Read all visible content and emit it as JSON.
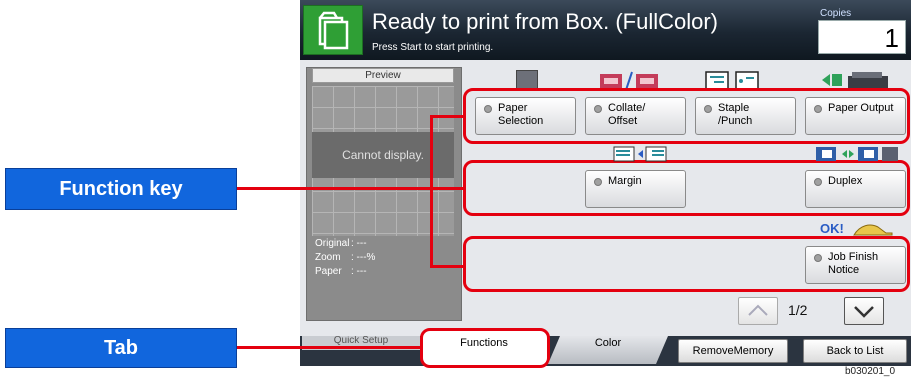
{
  "header": {
    "title": "Ready to print from Box. (FullColor)",
    "subtitle": "Press Start to start printing.",
    "copies_label": "Copies",
    "copies_value": "1"
  },
  "preview": {
    "tab_label": "Preview",
    "message": "Cannot display.",
    "info": [
      {
        "key": "Original",
        "value": ": ---"
      },
      {
        "key": "Zoom",
        "value": ": ---%"
      },
      {
        "key": "Paper",
        "value": ": ---"
      }
    ]
  },
  "functions": {
    "paper_selection": "Paper\nSelection",
    "collate_offset": "Collate/\nOffset",
    "staple_punch": "Staple\n/Punch",
    "paper_output": "Paper Output",
    "margin": "Margin",
    "duplex": "Duplex",
    "ok_text": "OK!",
    "job_finish_notice": "Job Finish\nNotice"
  },
  "pager": {
    "page": "1/2"
  },
  "tabs": {
    "quick_setup": "Quick Setup",
    "functions": "Functions",
    "color": "Color"
  },
  "bottom_buttons": {
    "remove_memory": "RemoveMemory",
    "back_to_list": "Back to List"
  },
  "callouts": {
    "function_key": "Function key",
    "tab": "Tab"
  },
  "figure_id": "b030201_0",
  "colors": {
    "callout_blue": "#1166dd",
    "highlight_red": "#e4000f",
    "header_dark": "#1b2632",
    "icon_green": "#2f9f35"
  }
}
